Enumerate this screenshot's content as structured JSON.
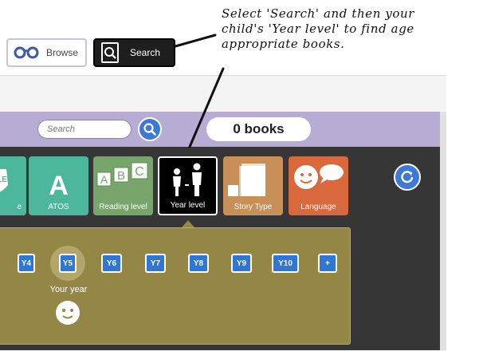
{
  "nav": {
    "browse_label": "Browse",
    "search_label": "Search"
  },
  "annotation": {
    "lines": [
      "Select 'Search' and then your",
      "child's 'Year level' to find age",
      "appropriate books."
    ]
  },
  "toolbar": {
    "search_placeholder": "Search",
    "book_count": "0 books"
  },
  "categories": [
    {
      "label": "e",
      "color": "#4cb79a",
      "icon": "partial-badge-icon"
    },
    {
      "label": "ATOS",
      "color": "#4cb79a",
      "icon": "letter-a-icon"
    },
    {
      "label": "Reading level",
      "color": "#78a56b",
      "icon": "abc-blocks-icon"
    },
    {
      "label": "Year level",
      "color": "#000000",
      "icon": "people-height-icon"
    },
    {
      "label": "Story Type",
      "color": "#c88f58",
      "icon": "books-icon"
    },
    {
      "label": "Language",
      "color": "#d9683d",
      "icon": "face-speech-icon"
    }
  ],
  "years": [
    "Y4",
    "Y5",
    "Y6",
    "Y7",
    "Y8",
    "Y9",
    "Y10",
    "+"
  ],
  "selected_year": "Y5",
  "your_year_label": "Your year",
  "colors": {
    "accent_blue": "#3d78d4",
    "purple_bar": "#b6acd4",
    "year_panel": "#948645",
    "dark_bg": "#363636"
  }
}
